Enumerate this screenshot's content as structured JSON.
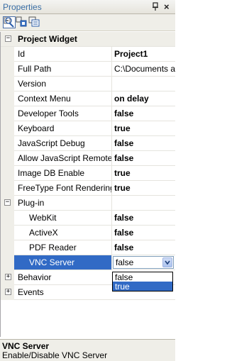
{
  "panel": {
    "title": "Properties"
  },
  "toolbar": {
    "buttons": [
      "categorized-icon",
      "alphabetical-icon",
      "property-pages-icon"
    ]
  },
  "grid": {
    "categories": {
      "project_widget": "Project Widget",
      "plugin": "Plug-in",
      "behavior": "Behavior",
      "events": "Events"
    },
    "project_widget_rows": [
      {
        "label": "Id",
        "value": "Project1"
      },
      {
        "label": "Full Path",
        "value": "C:\\Documents an"
      },
      {
        "label": "Version",
        "value": ""
      },
      {
        "label": "Context Menu",
        "value": "on delay"
      },
      {
        "label": "Developer Tools",
        "value": "false"
      },
      {
        "label": "Keyboard",
        "value": "true"
      },
      {
        "label": "JavaScript Debug",
        "value": "false"
      },
      {
        "label": "Allow JavaScript Remote De",
        "value": "false"
      },
      {
        "label": "Image DB Enable",
        "value": "true"
      },
      {
        "label": "FreeType Font Rendering",
        "value": "true"
      }
    ],
    "plugin_rows": [
      {
        "label": "WebKit",
        "value": "false"
      },
      {
        "label": "ActiveX",
        "value": "false"
      },
      {
        "label": "PDF Reader",
        "value": "false"
      },
      {
        "label": "VNC Server",
        "value": "false"
      }
    ],
    "dropdown_options": [
      "false",
      "true"
    ],
    "dropdown_highlighted": "true"
  },
  "description": {
    "name": "VNC Server",
    "text": "Enable/Disable VNC Server"
  }
}
